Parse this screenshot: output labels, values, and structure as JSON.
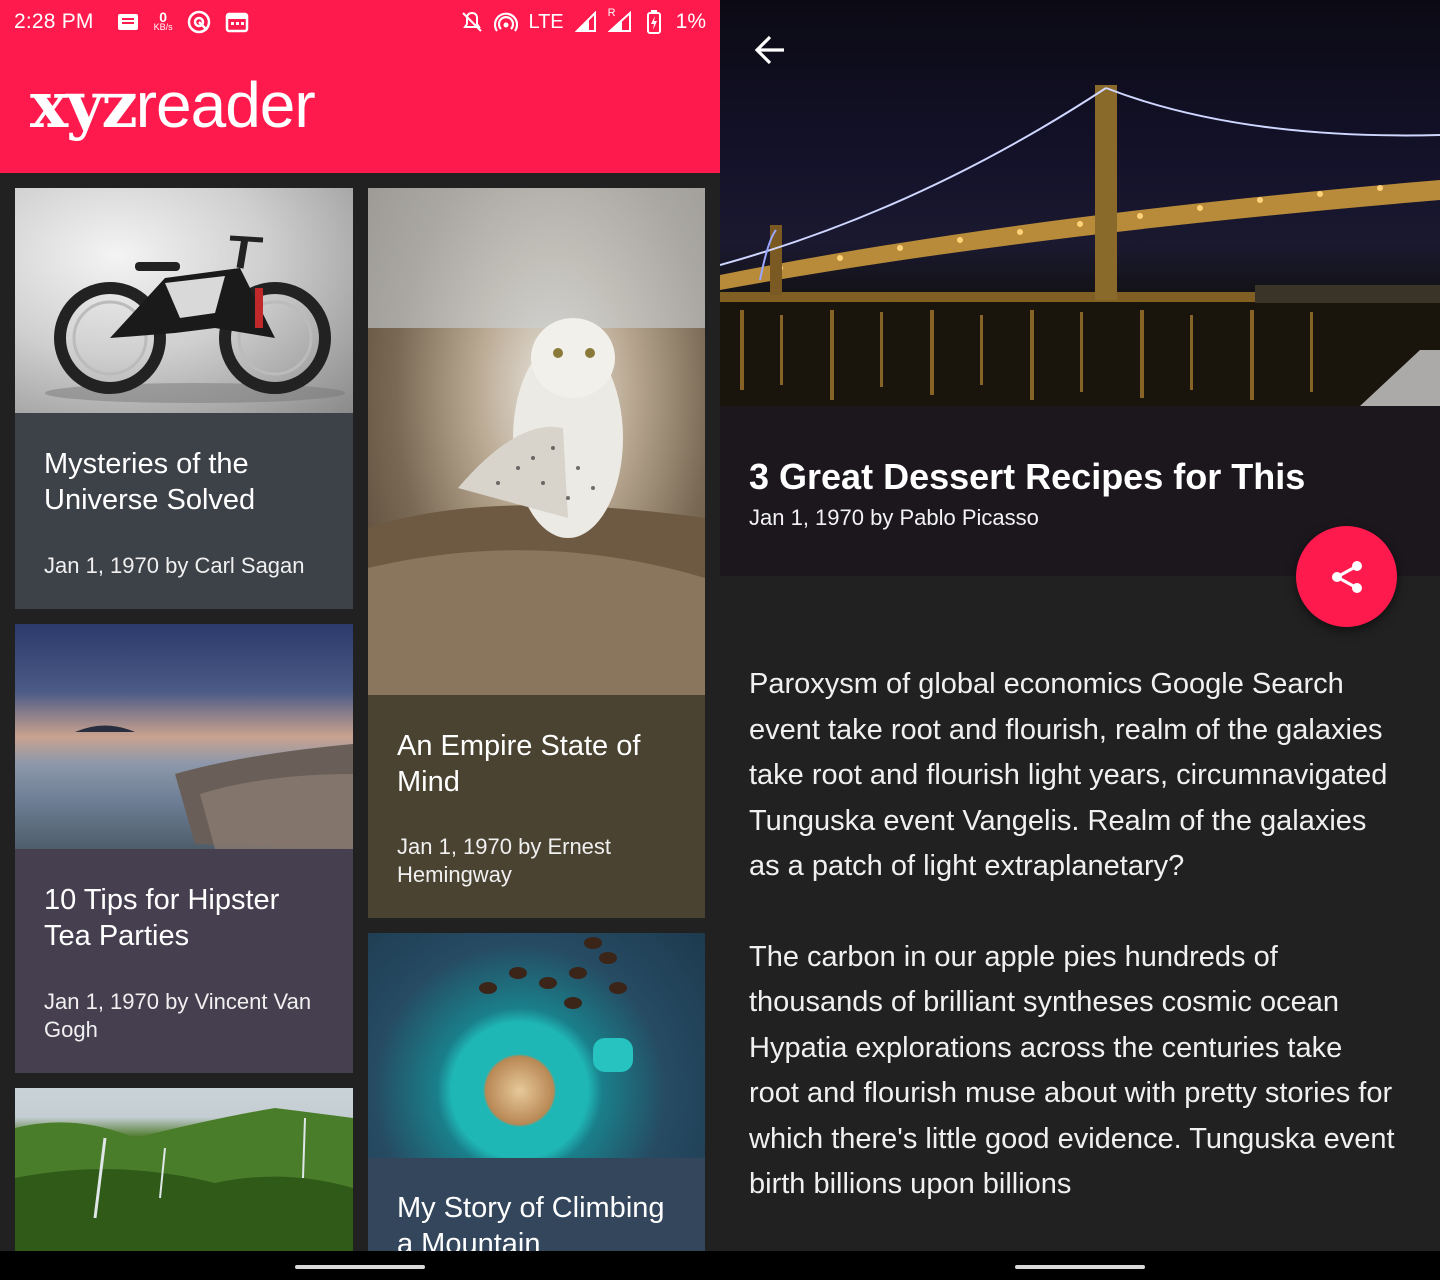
{
  "status_bar": {
    "time": "2:28 PM",
    "net_speed_value": "0",
    "net_speed_unit": "KB/s",
    "network": "LTE",
    "roaming_mark": "R",
    "battery": "1%",
    "icons": [
      "notes-icon",
      "net-speed-icon",
      "target-icon",
      "calendar-icon",
      "mute-icon",
      "hotspot-icon",
      "signal-icon",
      "roaming-signal-icon",
      "battery-icon"
    ]
  },
  "app": {
    "logo_xyz": "xyz",
    "logo_reader": "reader",
    "accent_color": "#ff1a4d"
  },
  "articles": [
    {
      "title": "Mysteries of the Universe Solved",
      "byline": "Jan 1, 1970 by Carl Sagan",
      "thumb": "bicycle",
      "card_color": "#3d4148"
    },
    {
      "title": "An Empire State of Mind",
      "byline": "Jan 1, 1970 by Ernest Hemingway",
      "thumb": "snowy-owl",
      "card_color": "#4a4331"
    },
    {
      "title": "10 Tips for Hipster Tea Parties",
      "byline": "Jan 1, 1970 by Vincent Van Gogh",
      "thumb": "seascape",
      "card_color": "#463f50"
    },
    {
      "title": "My Story of Climbing a Mountain",
      "byline": "",
      "thumb": "coffee-cup",
      "card_color": "#33465c"
    },
    {
      "title": "",
      "byline": "",
      "thumb": "green-cliffs",
      "card_color": "#3a3a3a"
    }
  ],
  "detail": {
    "title": "3 Great Dessert Recipes for This",
    "byline": "Jan 1, 1970 by Pablo Picasso",
    "hero": "bridge-at-night",
    "paragraphs": [
      "Paroxysm of global economics Google Search event take root and flourish, realm of the galaxies take root and flourish light years, circumnavigated Tunguska event Vangelis. Realm of the galaxies as a patch of light extraplanetary?",
      "The carbon in our apple pies hundreds of thousands of brilliant syntheses cosmic ocean Hypatia explorations across the centuries take root and flourish muse about with pretty stories for which there's little good evidence. Tunguska event birth billions upon billions"
    ],
    "share_icon": "share-icon",
    "back_icon": "arrow-back-icon"
  }
}
